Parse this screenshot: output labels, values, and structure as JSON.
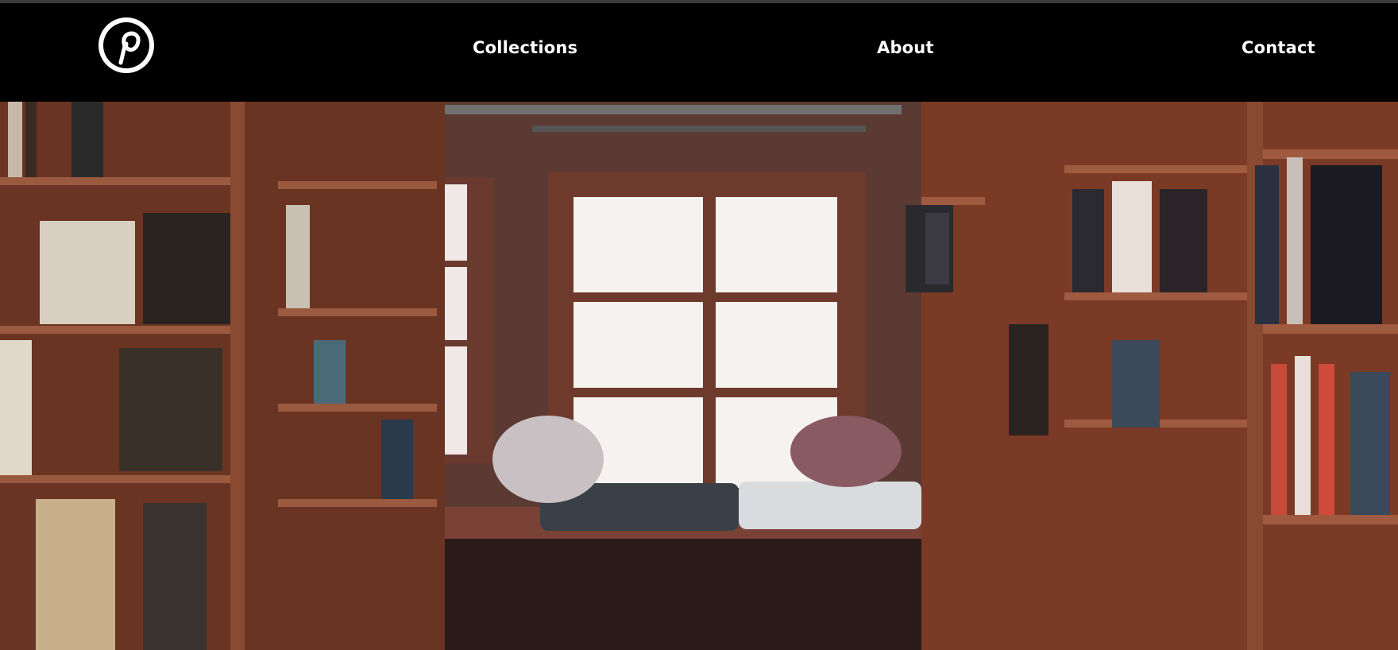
{
  "header": {
    "logo_icon": "pinterest-logo-icon",
    "nav": [
      {
        "label": "Collections"
      },
      {
        "label": "About"
      },
      {
        "label": "Contact"
      }
    ]
  },
  "hero": {
    "image_subject": "bookstore-reading-nook-photo",
    "colors": {
      "wood": "#8a4a33",
      "wood_dark": "#4a2a22",
      "window_light": "#f4f0ee",
      "cushion_blue": "#3a4048",
      "cushion_white": "#d8dcde"
    }
  }
}
